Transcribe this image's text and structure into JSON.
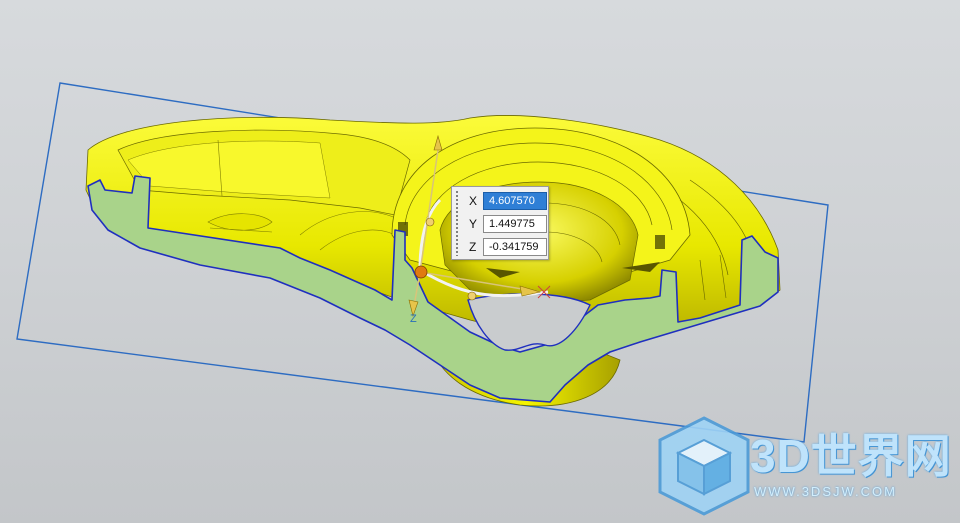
{
  "coordinates": {
    "x": {
      "label": "X",
      "value": "4.607570"
    },
    "y": {
      "label": "Y",
      "value": "1.449775"
    },
    "z": {
      "label": "Z",
      "value": "-0.341759"
    }
  },
  "triad_axis_label": "Z",
  "watermark": {
    "title": "3D世界网",
    "subtitle": "WWW.3DSJW.COM"
  },
  "colors": {
    "part_surface": "#f2f200",
    "section_fill": "#a9d38a",
    "section_outline": "#1f2fbf",
    "clip_plane_outline": "#2d6cc2",
    "background": "#cfd2d5"
  },
  "icons": [
    "coordinate-triad-icon",
    "watermark-cube-icon"
  ]
}
